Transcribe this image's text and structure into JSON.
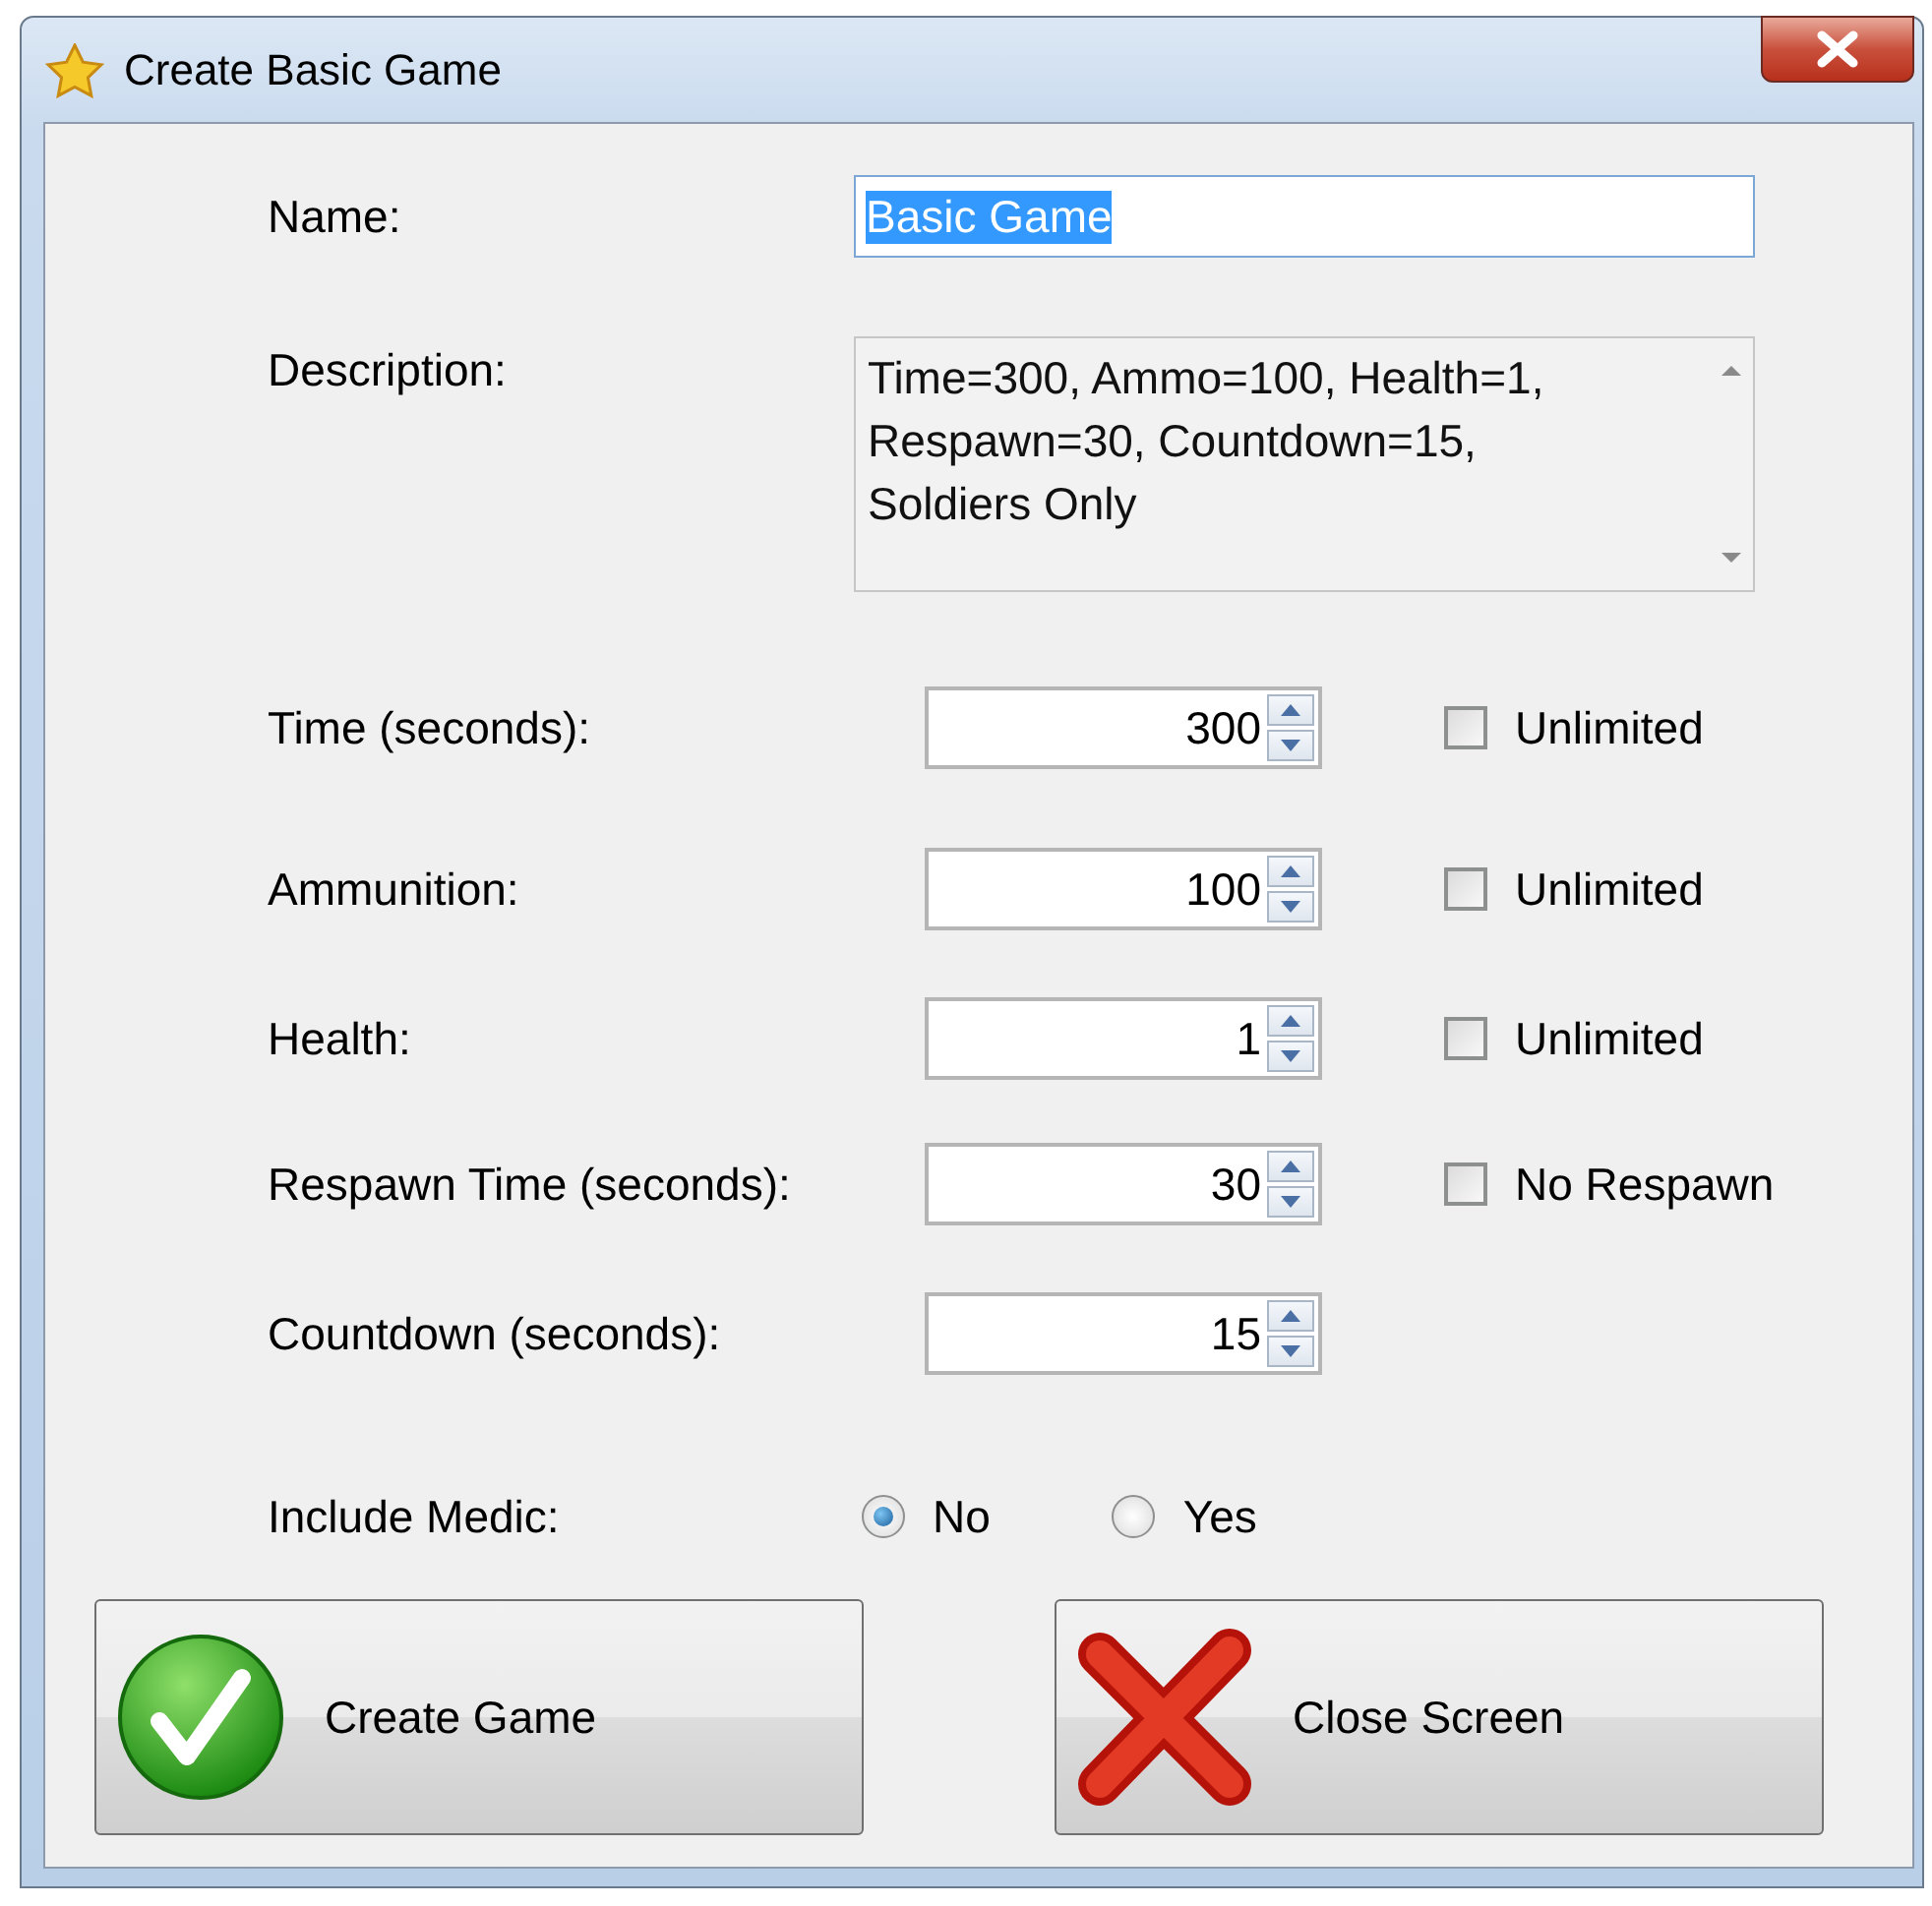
{
  "window": {
    "title": "Create Basic Game"
  },
  "name_field": {
    "label": "Name:",
    "value": "Basic Game",
    "text_selected": true
  },
  "description": {
    "label": "Description:",
    "value": "Time=300, Ammo=100, Health=1,\nRespawn=30, Countdown=15,\nSoldiers Only"
  },
  "settings": [
    {
      "label": "Time (seconds):",
      "value": "300",
      "option": {
        "label": "Unlimited",
        "checked": false
      }
    },
    {
      "label": "Ammunition:",
      "value": "100",
      "option": {
        "label": "Unlimited",
        "checked": false
      }
    },
    {
      "label": "Health:",
      "value": "1",
      "option": {
        "label": "Unlimited",
        "checked": false
      }
    },
    {
      "label": "Respawn Time (seconds):",
      "value": "30",
      "option": {
        "label": "No Respawn",
        "checked": false
      }
    },
    {
      "label": "Countdown (seconds):",
      "value": "15"
    }
  ],
  "include_medic": {
    "label": "Include Medic:",
    "options": [
      {
        "label": "No",
        "selected": true
      },
      {
        "label": "Yes",
        "selected": false
      }
    ]
  },
  "buttons": [
    {
      "kind": "confirm",
      "label": "Create Game"
    },
    {
      "kind": "cancel",
      "label": "Close Screen"
    }
  ]
}
